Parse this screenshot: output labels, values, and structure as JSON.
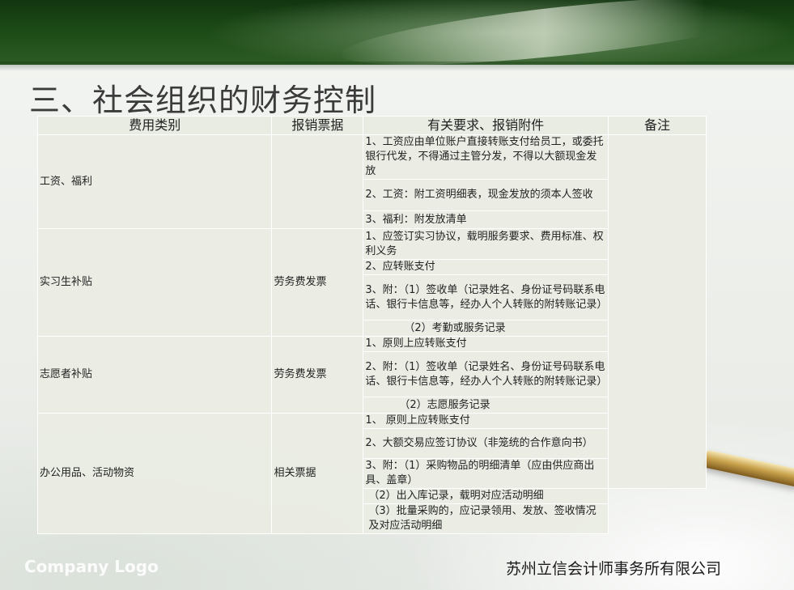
{
  "title": "三、社会组织的财务控制",
  "table": {
    "headers": [
      "费用类别",
      "报销票据",
      "有关要求、报销附件",
      "备注"
    ],
    "rows": [
      {
        "category": "工资、福利",
        "receipt": "",
        "requirements": [
          "1、工资应由单位账户直接转账支付给员工，或委托银行代发，不得通过主管分发，不得以大额现金发放",
          "2、工资：附工资明细表，现金发放的须本人签收",
          "3、福利：附发放清单"
        ]
      },
      {
        "category": "实习生补贴",
        "receipt": "劳务费发票",
        "requirements": [
          "1、应签订实习协议，载明服务要求、费用标准、权利义务",
          "2、应转账支付",
          "3、附：（1）签收单（记录姓名、身份证号码联系电话、银行卡信息等，经办人个人转账的附转账记录）",
          "（2）考勤或服务记录"
        ]
      },
      {
        "category": "志愿者补贴",
        "receipt": "劳务费发票",
        "requirements": [
          "1、原则上应转账支付",
          "2、附：（1）签收单（记录姓名、身份证号码联系电话、银行卡信息等，经办人个人转账的附转账记录）",
          "（2）志愿服务记录"
        ]
      },
      {
        "category": "办公用品、活动物资",
        "receipt": "相关票据",
        "requirements": [
          "1、 原则上应转账支付",
          "2、大额交易应签订协议（非笼统的合作意向书）",
          "3、附：（1）采购物品的明细清单（应由供应商出具、盖章）",
          "（2）出入库记录，载明对应活动明细",
          "（3）批量采购的，应记录领用、发放、签收情况及对应活动明细"
        ]
      }
    ]
  },
  "footer": {
    "logo": "Company Logo",
    "company": "苏州立信会计师事务所有限公司"
  }
}
